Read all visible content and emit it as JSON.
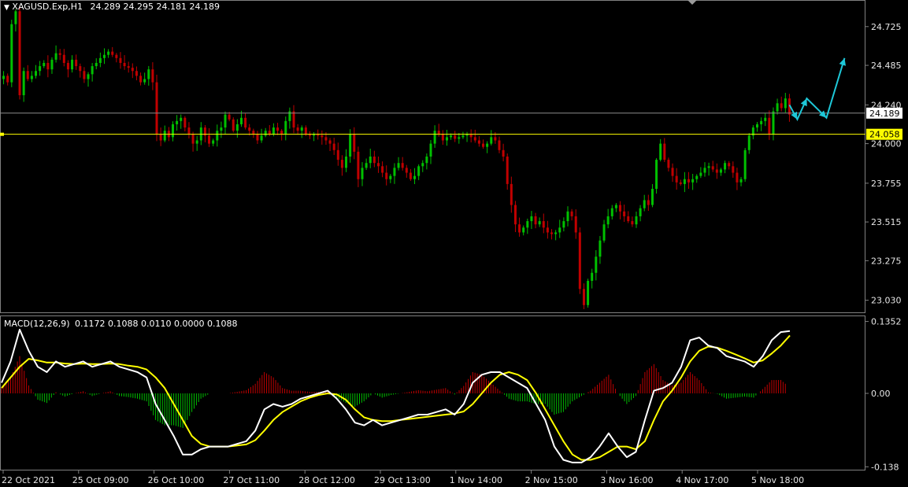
{
  "header": {
    "menu_arrow": "▼",
    "symbol": "XAGUSD.Exp,H1",
    "ohlc": "24.289 24.295 24.181 24.189"
  },
  "macd_header": {
    "label": "MACD(12,26,9)",
    "values": "0.1172 0.1088 0.0110 0.0000 0.1088"
  },
  "colors": {
    "background": "#000000",
    "bull": "#00c000",
    "bear": "#c00000",
    "level_line": "#ffff00",
    "bid_line": "#8c8c8c",
    "macd_line": "#ffffff",
    "signal_line": "#ffff00",
    "arrow": "#1ec8d8",
    "grid": "#808080"
  },
  "chart_data": [
    {
      "type": "candlestick",
      "title": "XAGUSD.Exp,H1",
      "ylim": [
        22.96,
        24.88
      ],
      "y_ticks": [
        "24.725",
        "24.485",
        "24.240",
        "24.000",
        "23.755",
        "23.515",
        "23.275",
        "23.030"
      ],
      "y_tick_values": [
        24.725,
        24.485,
        24.24,
        24.0,
        23.755,
        23.515,
        23.275,
        23.03
      ],
      "current_price": {
        "label": "24.189",
        "value": 24.189
      },
      "horizontal_level": {
        "label": "24.058",
        "value": 24.058
      },
      "x_labels": [
        "22 Oct 2021",
        "25 Oct 09:00",
        "26 Oct 10:00",
        "27 Oct 11:00",
        "28 Oct 12:00",
        "29 Oct 13:00",
        "1 Nov 14:00",
        "2 Nov 15:00",
        "3 Nov 16:00",
        "4 Nov 17:00",
        "5 Nov 18:00"
      ],
      "closes": [
        24.42,
        24.38,
        24.74,
        24.82,
        24.3,
        24.45,
        24.4,
        24.42,
        24.45,
        24.48,
        24.5,
        24.46,
        24.52,
        24.56,
        24.55,
        24.5,
        24.46,
        24.52,
        24.48,
        24.45,
        24.4,
        24.43,
        24.48,
        24.5,
        24.53,
        24.55,
        24.57,
        24.55,
        24.53,
        24.5,
        24.48,
        24.47,
        24.45,
        24.42,
        24.38,
        24.4,
        24.46,
        24.38,
        24.06,
        24.02,
        24.08,
        24.04,
        24.12,
        24.14,
        24.16,
        24.1,
        24.06,
        24.0,
        24.02,
        24.1,
        24.05,
        24.0,
        24.02,
        24.08,
        24.1,
        24.18,
        24.15,
        24.08,
        24.12,
        24.16,
        24.1,
        24.08,
        24.06,
        24.02,
        24.05,
        24.08,
        24.06,
        24.1,
        24.08,
        24.06,
        24.14,
        24.2,
        24.1,
        24.08,
        24.1,
        24.06,
        24.05,
        24.06,
        24.05,
        24.04,
        24.02,
        24.0,
        23.96,
        23.9,
        23.85,
        23.92,
        24.06,
        23.95,
        23.78,
        23.85,
        23.88,
        23.92,
        23.88,
        23.86,
        23.82,
        23.78,
        23.8,
        23.85,
        23.88,
        23.85,
        23.82,
        23.78,
        23.8,
        23.86,
        23.88,
        23.92,
        24.0,
        24.08,
        24.06,
        24.02,
        24.04,
        24.05,
        24.03,
        24.04,
        24.05,
        24.06,
        24.04,
        24.02,
        24.0,
        23.98,
        24.0,
        24.04,
        24.02,
        23.96,
        23.92,
        23.75,
        23.62,
        23.5,
        23.45,
        23.48,
        23.52,
        23.55,
        23.5,
        23.52,
        23.48,
        23.45,
        23.44,
        23.45,
        23.48,
        23.52,
        23.58,
        23.55,
        23.45,
        23.1,
        23.0,
        23.15,
        23.2,
        23.3,
        23.4,
        23.5,
        23.55,
        23.6,
        23.62,
        23.58,
        23.55,
        23.52,
        23.5,
        23.55,
        23.6,
        23.65,
        23.62,
        23.72,
        23.9,
        24.0,
        23.9,
        23.85,
        23.8,
        23.76,
        23.75,
        23.78,
        23.76,
        23.78,
        23.8,
        23.82,
        23.85,
        23.86,
        23.84,
        23.82,
        23.84,
        23.88,
        23.86,
        23.82,
        23.76,
        23.78,
        23.96,
        24.05,
        24.1,
        24.12,
        24.14,
        24.16,
        24.06,
        24.2,
        24.25,
        24.22,
        24.28,
        24.18
      ]
    },
    {
      "type": "macd",
      "title": "MACD(12,26,9)",
      "params": [
        12,
        26,
        9
      ],
      "ylim": [
        -0.142,
        0.142
      ],
      "y_ticks": [
        "0.1352",
        "0.00",
        "-0.138"
      ],
      "y_tick_values": [
        0.1352,
        0.0,
        -0.138
      ],
      "series": [
        {
          "name": "MACD",
          "values": [
            0.02,
            0.06,
            0.12,
            0.08,
            0.05,
            0.04,
            0.06,
            0.05,
            0.055,
            0.06,
            0.05,
            0.055,
            0.06,
            0.05,
            0.045,
            0.04,
            0.03,
            -0.02,
            -0.05,
            -0.08,
            -0.115,
            -0.115,
            -0.105,
            -0.1,
            -0.1,
            -0.1,
            -0.095,
            -0.09,
            -0.07,
            -0.03,
            -0.02,
            -0.025,
            -0.02,
            -0.01,
            -0.005,
            0.0,
            0.005,
            -0.01,
            -0.03,
            -0.055,
            -0.06,
            -0.05,
            -0.06,
            -0.055,
            -0.05,
            -0.045,
            -0.04,
            -0.04,
            -0.035,
            -0.03,
            -0.04,
            -0.02,
            0.02,
            0.035,
            0.04,
            0.04,
            0.03,
            0.02,
            0.01,
            -0.02,
            -0.05,
            -0.1,
            -0.125,
            -0.13,
            -0.13,
            -0.12,
            -0.1,
            -0.075,
            -0.1,
            -0.12,
            -0.11,
            -0.05,
            0.005,
            0.01,
            0.02,
            0.05,
            0.1,
            0.105,
            0.09,
            0.085,
            0.07,
            0.065,
            0.06,
            0.05,
            0.07,
            0.1,
            0.1152,
            0.1172
          ]
        },
        {
          "name": "Signal",
          "values": [
            0.01,
            0.03,
            0.05,
            0.065,
            0.062,
            0.058,
            0.058,
            0.056,
            0.055,
            0.056,
            0.055,
            0.055,
            0.056,
            0.055,
            0.052,
            0.05,
            0.045,
            0.03,
            0.01,
            -0.02,
            -0.05,
            -0.08,
            -0.095,
            -0.1,
            -0.1,
            -0.1,
            -0.098,
            -0.096,
            -0.088,
            -0.07,
            -0.05,
            -0.035,
            -0.025,
            -0.015,
            -0.008,
            -0.003,
            0.0,
            -0.002,
            -0.012,
            -0.03,
            -0.045,
            -0.05,
            -0.052,
            -0.052,
            -0.05,
            -0.048,
            -0.046,
            -0.044,
            -0.042,
            -0.04,
            -0.038,
            -0.034,
            -0.02,
            0.0,
            0.02,
            0.035,
            0.04,
            0.035,
            0.025,
            0.0,
            -0.03,
            -0.06,
            -0.09,
            -0.115,
            -0.125,
            -0.125,
            -0.12,
            -0.11,
            -0.1,
            -0.1,
            -0.105,
            -0.09,
            -0.05,
            -0.015,
            0.005,
            0.03,
            0.06,
            0.08,
            0.088,
            0.086,
            0.08,
            0.073,
            0.066,
            0.058,
            0.062,
            0.075,
            0.09,
            0.1088
          ]
        },
        {
          "name": "Histogram",
          "values": [
            0.01,
            0.03,
            0.07,
            0.015,
            -0.012,
            -0.018,
            0.002,
            -0.006,
            0.0,
            0.004,
            -0.005,
            0.0,
            0.004,
            -0.005,
            -0.007,
            -0.01,
            -0.015,
            -0.05,
            -0.06,
            -0.06,
            -0.065,
            -0.035,
            -0.01,
            0.0,
            0.0,
            0.0,
            0.003,
            0.006,
            0.018,
            0.04,
            0.03,
            0.01,
            0.005,
            0.005,
            0.003,
            0.003,
            0.005,
            -0.008,
            -0.018,
            -0.025,
            -0.015,
            0.0,
            -0.008,
            -0.003,
            0.0,
            0.003,
            0.006,
            0.004,
            0.007,
            0.01,
            -0.002,
            0.014,
            0.04,
            0.035,
            0.02,
            0.005,
            -0.01,
            -0.015,
            -0.015,
            -0.02,
            -0.02,
            -0.04,
            -0.035,
            -0.015,
            -0.005,
            0.005,
            0.02,
            0.035,
            0.0,
            -0.02,
            -0.005,
            0.04,
            0.055,
            0.025,
            0.015,
            0.02,
            0.04,
            0.025,
            0.002,
            -0.001,
            -0.01,
            -0.008,
            -0.006,
            -0.008,
            0.008,
            0.025,
            0.0252,
            0.011
          ]
        }
      ]
    }
  ]
}
